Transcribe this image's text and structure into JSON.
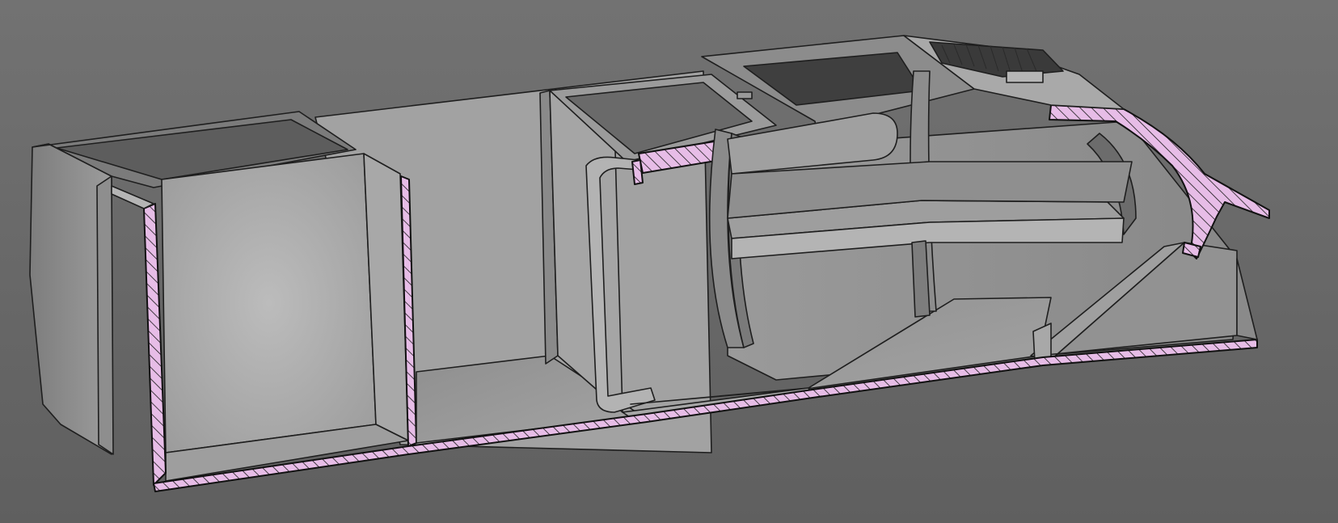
{
  "viewport": {
    "background": "#676767",
    "model_colors": {
      "body_light": "#a9a9a9",
      "body_mid": "#8e8e8e",
      "body_dark": "#626262",
      "interior_shadow": "#4a4a4a",
      "section_fill": "#e7bde7",
      "section_hatch": "#1a1a1a"
    }
  }
}
